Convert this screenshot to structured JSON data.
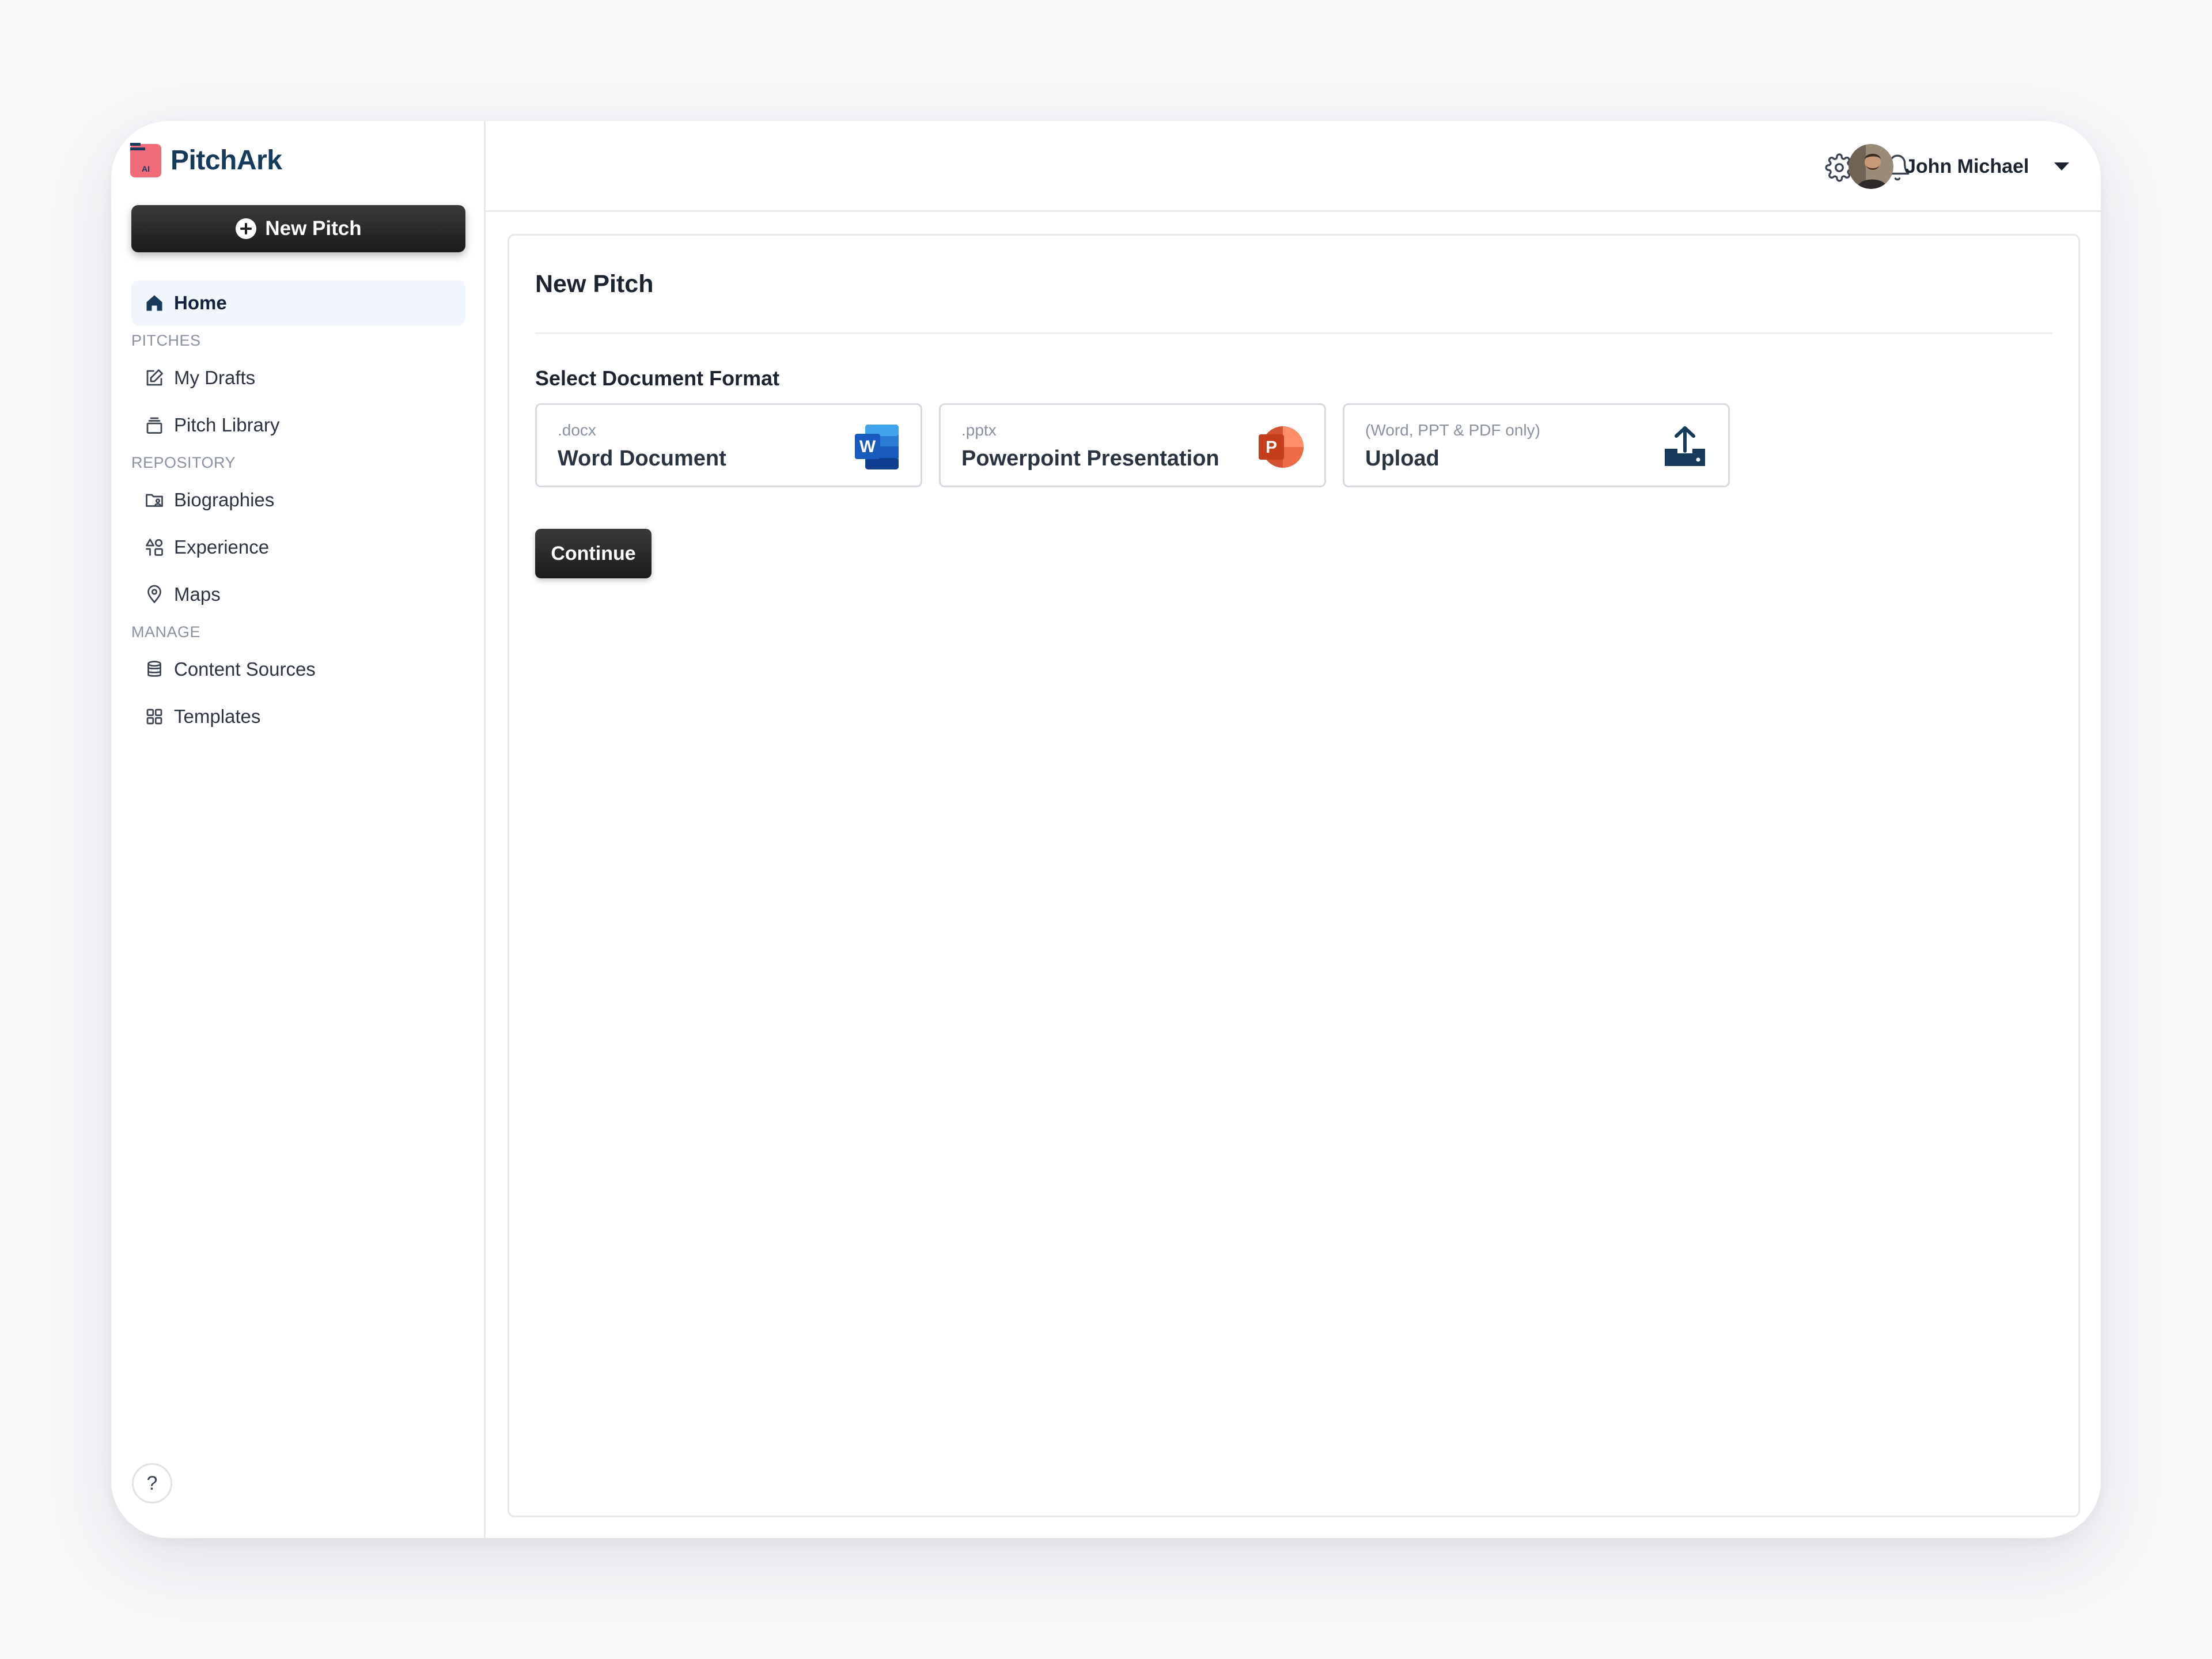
{
  "app": {
    "name": "PitchArk",
    "logo_badge": "AI"
  },
  "sidebar": {
    "new_pitch_label": "New Pitch",
    "home_label": "Home",
    "sections": {
      "pitches": "PITCHES",
      "repository": "REPOSITORY",
      "manage": "MANAGE"
    },
    "items": {
      "my_drafts": "My Drafts",
      "pitch_library": "Pitch Library",
      "biographies": "Biographies",
      "experience": "Experience",
      "maps": "Maps",
      "content_sources": "Content Sources",
      "templates": "Templates"
    },
    "help_label": "?"
  },
  "header": {
    "user_name": "John Michael",
    "icons": [
      "gear-icon",
      "bell-icon",
      "chevron-down-icon"
    ]
  },
  "main": {
    "title": "New Pitch",
    "section_label": "Select Document Format",
    "formats": [
      {
        "ext": ".docx",
        "name": "Word Document",
        "icon": "word-icon",
        "color": "#185abd"
      },
      {
        "ext": ".pptx",
        "name": "Powerpoint Presentation",
        "icon": "powerpoint-icon",
        "color": "#d24726"
      },
      {
        "ext": "(Word, PPT & PDF only)",
        "name": "Upload",
        "icon": "upload-icon",
        "color": "#163a5a"
      }
    ],
    "continue_label": "Continue"
  },
  "colors": {
    "brand_navy": "#163a5a",
    "logo_pink": "#f26b7a",
    "button_dark": "#1b1b1d",
    "active_nav_bg": "#f1f5fc"
  }
}
